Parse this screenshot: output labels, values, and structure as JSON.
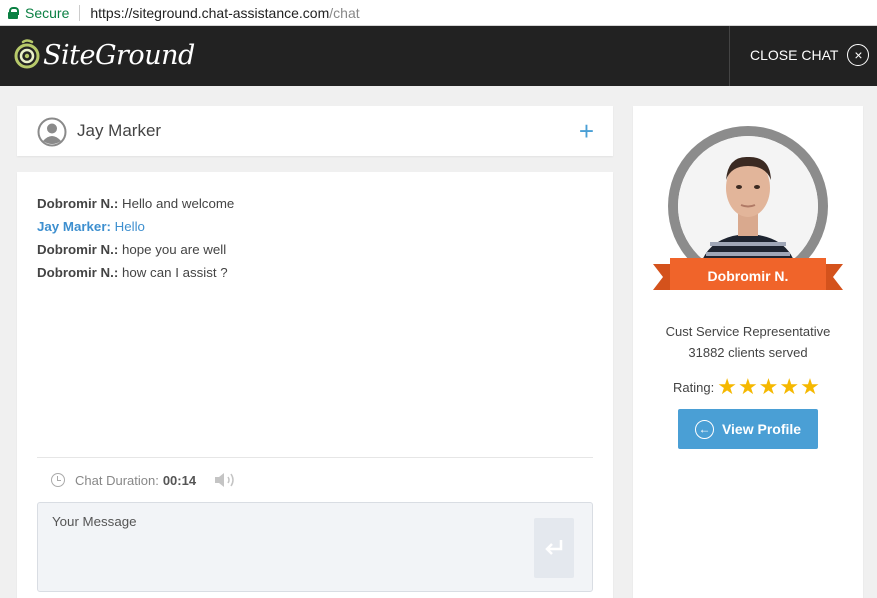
{
  "browser": {
    "secure_label": "Secure",
    "url_main": "https://siteground.chat-assistance.com",
    "url_path": "/chat"
  },
  "header": {
    "logo_text": "SiteGround",
    "close_label": "CLOSE CHAT",
    "close_icon": "×"
  },
  "session": {
    "user_name": "Jay Marker",
    "add_icon": "+"
  },
  "messages": [
    {
      "sender": "Dobromir N.:",
      "text": "Hello and welcome"
    },
    {
      "sender": "Jay Marker:",
      "text": "Hello"
    },
    {
      "sender": "Dobromir N.:",
      "text": "hope you are well"
    },
    {
      "sender": "Dobromir N.:",
      "text": "how can I assist ?"
    }
  ],
  "chat": {
    "duration_label": "Chat Duration:",
    "duration_value": "00:14",
    "input_placeholder": "Your Message"
  },
  "agent": {
    "name": "Dobromir N.",
    "role": "Cust Service Representative",
    "clients_served": "31882 clients served",
    "rating_label": "Rating:",
    "rating": 5,
    "rating_max": 5,
    "view_profile_label": "View Profile"
  },
  "colors": {
    "accent": "#4a9fd5",
    "header_bg": "#222222",
    "ribbon": "#f0642a",
    "star": "#f5b800",
    "secure_green": "#0b8043"
  }
}
